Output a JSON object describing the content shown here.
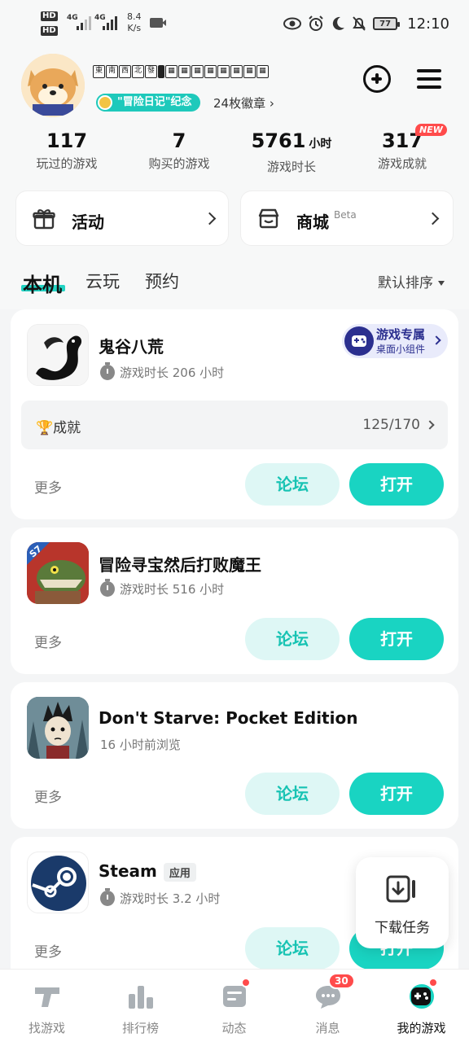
{
  "status_bar": {
    "hd1": "HD",
    "hd2": "HD",
    "net1": "4G",
    "net2": "4G",
    "speed_value": "8.4",
    "speed_unit": "K/s",
    "battery": "77",
    "time": "12:10"
  },
  "profile": {
    "username_glyphs": [
      "東",
      "南",
      "西",
      "北",
      "發",
      "▮",
      "▦",
      "▦",
      "▦",
      "▦",
      "▦",
      "▦",
      "▦",
      "▦",
      "▦"
    ],
    "badge_label": "\"冒险日记\"纪念",
    "badge_count": "24枚徽章 ›"
  },
  "stats": [
    {
      "value": "117",
      "unit": "",
      "label": "玩过的游戏"
    },
    {
      "value": "7",
      "unit": "",
      "label": "购买的游戏"
    },
    {
      "value": "5761",
      "unit": "小时",
      "label": "游戏时长"
    },
    {
      "value": "317",
      "unit": "",
      "label": "游戏成就"
    }
  ],
  "new_badge": "NEW",
  "quick": {
    "activity": "活动",
    "mall": "商城",
    "mall_beta": "Beta"
  },
  "tabs": {
    "local": "本机",
    "cloud": "云玩",
    "reserve": "预约",
    "sort": "默认排序"
  },
  "games": [
    {
      "title": "鬼谷八荒",
      "subtitle": "游戏时长 206 小时",
      "widget_line1": "游戏专属",
      "widget_line2": "桌面小组件",
      "ach_label": "🏆成就",
      "ach_value": "125/170",
      "more": "更多",
      "forum": "论坛",
      "open": "打开"
    },
    {
      "title": "冒险寻宝然后打败魔王",
      "subtitle": "游戏时长 516 小时",
      "icon_badge": "S7",
      "more": "更多",
      "forum": "论坛",
      "open": "打开"
    },
    {
      "title": "Don't Starve: Pocket Edition",
      "subtitle": "16 小时前浏览",
      "more": "更多",
      "forum": "论坛",
      "open": "打开"
    },
    {
      "title": "Steam",
      "tag": "应用",
      "subtitle": "游戏时长 3.2 小时",
      "more": "更多",
      "forum": "论坛",
      "open": "打开"
    }
  ],
  "float_download": "下载任务",
  "bottom_nav": [
    {
      "label": "找游戏"
    },
    {
      "label": "排行榜"
    },
    {
      "label": "动态"
    },
    {
      "label": "消息",
      "badge": "30"
    },
    {
      "label": "我的游戏"
    }
  ],
  "colors": {
    "accent": "#19d4c2",
    "accent_light": "#def7f5",
    "badge_red": "#ff4b4b",
    "widget_navy": "#2b2f8f"
  }
}
